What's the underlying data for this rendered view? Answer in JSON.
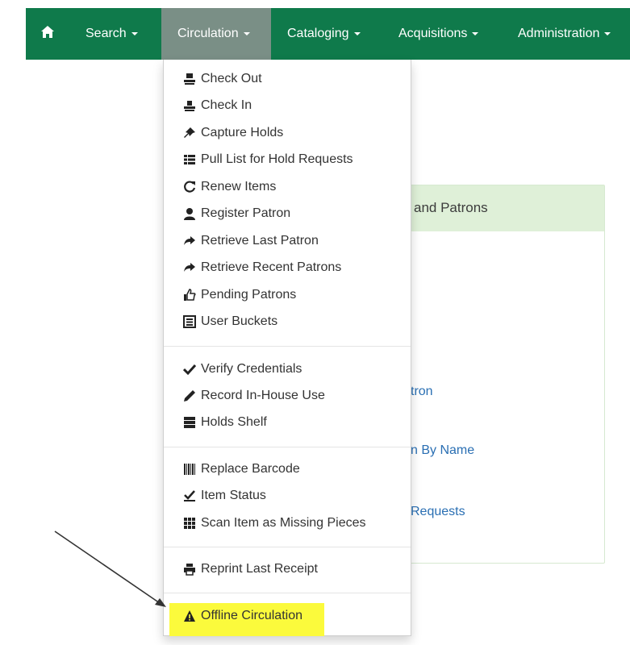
{
  "navbar": {
    "items": [
      {
        "label": "Search"
      },
      {
        "label": "Circulation"
      },
      {
        "label": "Cataloging"
      },
      {
        "label": "Acquisitions"
      },
      {
        "label": "Administration"
      }
    ],
    "home_icon": "home-icon",
    "background_color": "#0f7a4b",
    "active_color": "#7a8f86"
  },
  "panel": {
    "heading": "and Patrons",
    "links": [
      "tron",
      "n By Name",
      "Requests"
    ]
  },
  "dropdown": {
    "items": [
      {
        "label": "Check Out",
        "icon": "check-out-icon"
      },
      {
        "label": "Check In",
        "icon": "check-in-icon"
      },
      {
        "label": "Capture Holds",
        "icon": "pushpin-icon"
      },
      {
        "label": "Pull List for Hold Requests",
        "icon": "list-icon"
      },
      {
        "label": "Renew Items",
        "icon": "refresh-icon"
      },
      {
        "label": "Register Patron",
        "icon": "user-icon"
      },
      {
        "label": "Retrieve Last Patron",
        "icon": "share-arrow-icon"
      },
      {
        "label": "Retrieve Recent Patrons",
        "icon": "share-arrow-icon"
      },
      {
        "label": "Pending Patrons",
        "icon": "thumbs-up-icon"
      },
      {
        "label": "User Buckets",
        "icon": "list-alt-icon"
      },
      {
        "label": "Verify Credentials",
        "icon": "checkmark-icon"
      },
      {
        "label": "Record In-House Use",
        "icon": "pencil-icon"
      },
      {
        "label": "Holds Shelf",
        "icon": "tasks-icon"
      },
      {
        "label": "Replace Barcode",
        "icon": "barcode-icon"
      },
      {
        "label": "Item Status",
        "icon": "saved-icon"
      },
      {
        "label": "Scan Item as Missing Pieces",
        "icon": "grid-icon"
      },
      {
        "label": "Reprint Last Receipt",
        "icon": "print-icon"
      },
      {
        "label": "Offline Circulation",
        "icon": "warning-icon"
      }
    ],
    "highlight_color": "#fbfa3c"
  }
}
